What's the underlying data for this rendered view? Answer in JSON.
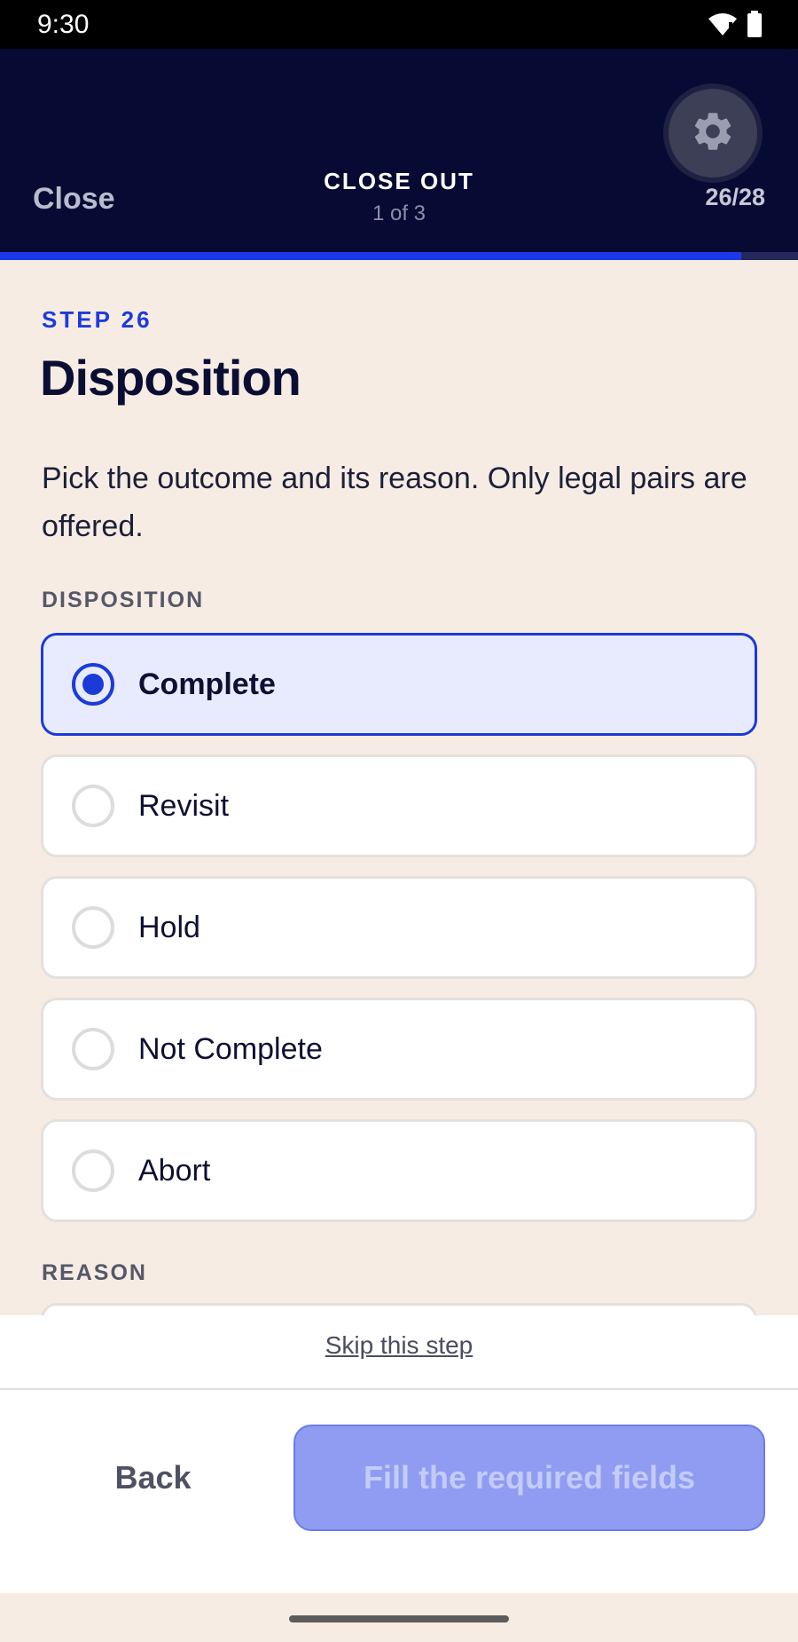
{
  "status_bar": {
    "time": "9:30"
  },
  "header": {
    "close_label": "Close",
    "title": "CLOSE OUT",
    "subtitle": "1 of 3",
    "counter": "26/28",
    "progress": 0.929
  },
  "step": {
    "label": "STEP 26",
    "title": "Disposition",
    "description": "Pick the outcome and its reason. Only legal pairs are offered."
  },
  "disposition": {
    "section_label": "DISPOSITION",
    "options": [
      {
        "label": "Complete",
        "selected": true
      },
      {
        "label": "Revisit",
        "selected": false
      },
      {
        "label": "Hold",
        "selected": false
      },
      {
        "label": "Not Complete",
        "selected": false
      },
      {
        "label": "Abort",
        "selected": false
      }
    ]
  },
  "reason": {
    "section_label": "REASON"
  },
  "footer": {
    "skip_label": "Skip this step",
    "back_label": "Back",
    "primary_label": "Fill the required fields"
  },
  "colors": {
    "header_bg": "#070a33",
    "accent": "#1a3bd8",
    "page_bg": "#f7ece3",
    "primary_disabled": "#8f9cf1"
  }
}
